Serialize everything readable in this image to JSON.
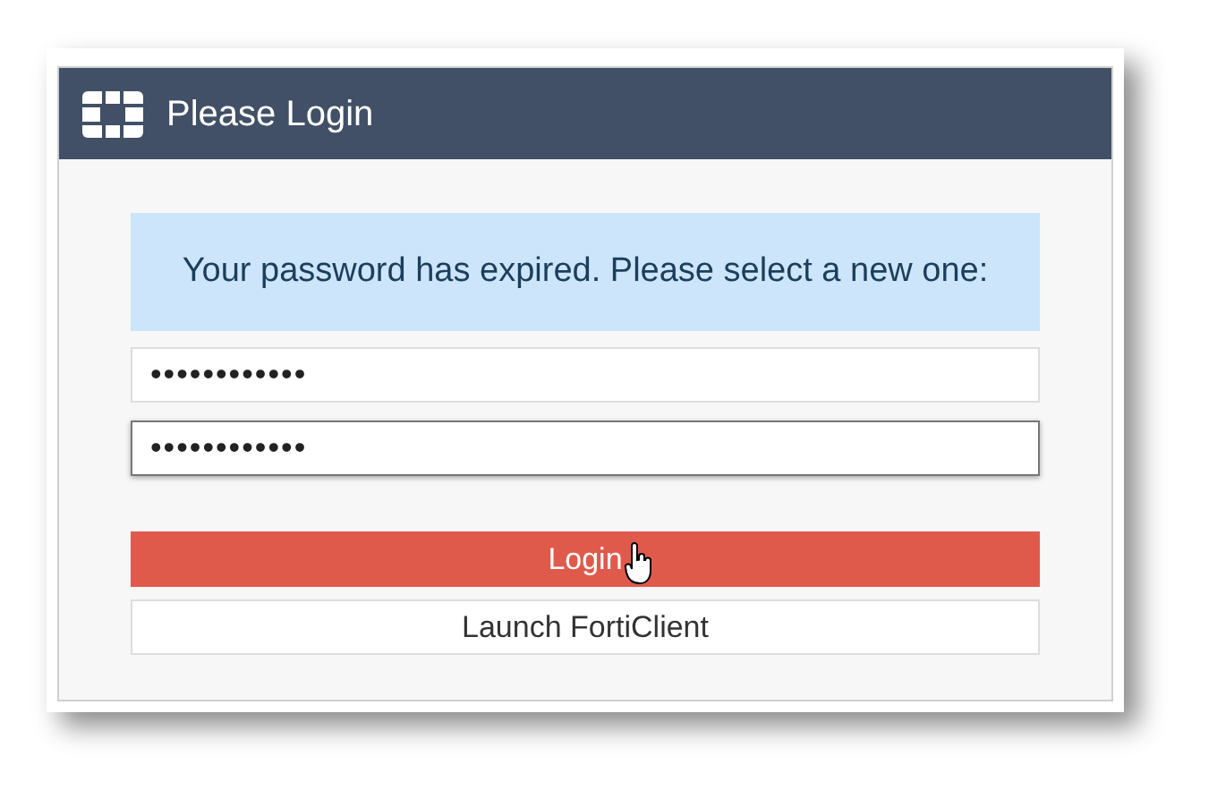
{
  "dialog": {
    "title": "Please Login"
  },
  "message": "Your password has expired. Please select a new one:",
  "fields": [
    {
      "value": "••••••••••••",
      "focused": false
    },
    {
      "value": "••••••••••••",
      "focused": true
    }
  ],
  "buttons": [
    {
      "label": "Login",
      "kind": "primary",
      "hovered": true
    },
    {
      "label": "Launch FortiClient",
      "kind": "secondary",
      "hovered": false
    }
  ]
}
